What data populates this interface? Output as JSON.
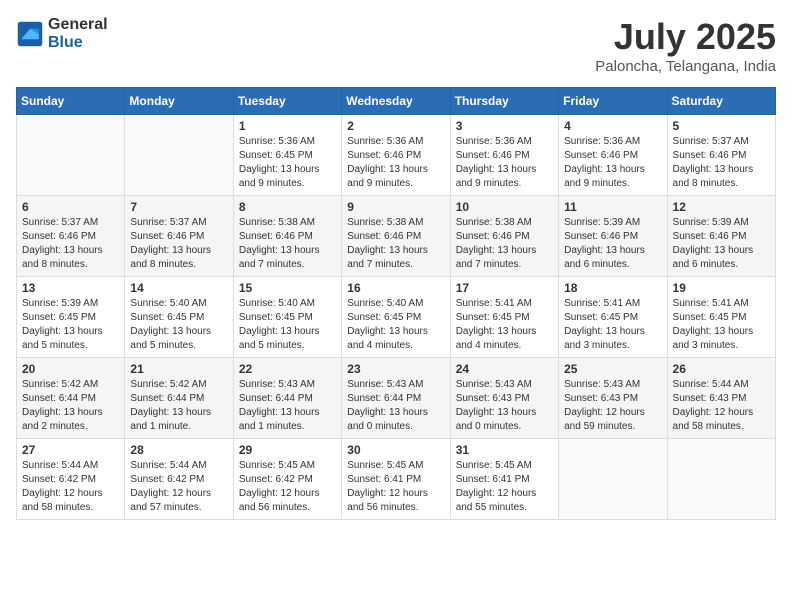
{
  "logo": {
    "general": "General",
    "blue": "Blue"
  },
  "header": {
    "month": "July 2025",
    "location": "Paloncha, Telangana, India"
  },
  "weekdays": [
    "Sunday",
    "Monday",
    "Tuesday",
    "Wednesday",
    "Thursday",
    "Friday",
    "Saturday"
  ],
  "weeks": [
    [
      {
        "day": "",
        "info": ""
      },
      {
        "day": "",
        "info": ""
      },
      {
        "day": "1",
        "info": "Sunrise: 5:36 AM\nSunset: 6:45 PM\nDaylight: 13 hours and 9 minutes."
      },
      {
        "day": "2",
        "info": "Sunrise: 5:36 AM\nSunset: 6:46 PM\nDaylight: 13 hours and 9 minutes."
      },
      {
        "day": "3",
        "info": "Sunrise: 5:36 AM\nSunset: 6:46 PM\nDaylight: 13 hours and 9 minutes."
      },
      {
        "day": "4",
        "info": "Sunrise: 5:36 AM\nSunset: 6:46 PM\nDaylight: 13 hours and 9 minutes."
      },
      {
        "day": "5",
        "info": "Sunrise: 5:37 AM\nSunset: 6:46 PM\nDaylight: 13 hours and 8 minutes."
      }
    ],
    [
      {
        "day": "6",
        "info": "Sunrise: 5:37 AM\nSunset: 6:46 PM\nDaylight: 13 hours and 8 minutes."
      },
      {
        "day": "7",
        "info": "Sunrise: 5:37 AM\nSunset: 6:46 PM\nDaylight: 13 hours and 8 minutes."
      },
      {
        "day": "8",
        "info": "Sunrise: 5:38 AM\nSunset: 6:46 PM\nDaylight: 13 hours and 7 minutes."
      },
      {
        "day": "9",
        "info": "Sunrise: 5:38 AM\nSunset: 6:46 PM\nDaylight: 13 hours and 7 minutes."
      },
      {
        "day": "10",
        "info": "Sunrise: 5:38 AM\nSunset: 6:46 PM\nDaylight: 13 hours and 7 minutes."
      },
      {
        "day": "11",
        "info": "Sunrise: 5:39 AM\nSunset: 6:46 PM\nDaylight: 13 hours and 6 minutes."
      },
      {
        "day": "12",
        "info": "Sunrise: 5:39 AM\nSunset: 6:46 PM\nDaylight: 13 hours and 6 minutes."
      }
    ],
    [
      {
        "day": "13",
        "info": "Sunrise: 5:39 AM\nSunset: 6:45 PM\nDaylight: 13 hours and 5 minutes."
      },
      {
        "day": "14",
        "info": "Sunrise: 5:40 AM\nSunset: 6:45 PM\nDaylight: 13 hours and 5 minutes."
      },
      {
        "day": "15",
        "info": "Sunrise: 5:40 AM\nSunset: 6:45 PM\nDaylight: 13 hours and 5 minutes."
      },
      {
        "day": "16",
        "info": "Sunrise: 5:40 AM\nSunset: 6:45 PM\nDaylight: 13 hours and 4 minutes."
      },
      {
        "day": "17",
        "info": "Sunrise: 5:41 AM\nSunset: 6:45 PM\nDaylight: 13 hours and 4 minutes."
      },
      {
        "day": "18",
        "info": "Sunrise: 5:41 AM\nSunset: 6:45 PM\nDaylight: 13 hours and 3 minutes."
      },
      {
        "day": "19",
        "info": "Sunrise: 5:41 AM\nSunset: 6:45 PM\nDaylight: 13 hours and 3 minutes."
      }
    ],
    [
      {
        "day": "20",
        "info": "Sunrise: 5:42 AM\nSunset: 6:44 PM\nDaylight: 13 hours and 2 minutes."
      },
      {
        "day": "21",
        "info": "Sunrise: 5:42 AM\nSunset: 6:44 PM\nDaylight: 13 hours and 1 minute."
      },
      {
        "day": "22",
        "info": "Sunrise: 5:43 AM\nSunset: 6:44 PM\nDaylight: 13 hours and 1 minutes."
      },
      {
        "day": "23",
        "info": "Sunrise: 5:43 AM\nSunset: 6:44 PM\nDaylight: 13 hours and 0 minutes."
      },
      {
        "day": "24",
        "info": "Sunrise: 5:43 AM\nSunset: 6:43 PM\nDaylight: 13 hours and 0 minutes."
      },
      {
        "day": "25",
        "info": "Sunrise: 5:43 AM\nSunset: 6:43 PM\nDaylight: 12 hours and 59 minutes."
      },
      {
        "day": "26",
        "info": "Sunrise: 5:44 AM\nSunset: 6:43 PM\nDaylight: 12 hours and 58 minutes."
      }
    ],
    [
      {
        "day": "27",
        "info": "Sunrise: 5:44 AM\nSunset: 6:42 PM\nDaylight: 12 hours and 58 minutes."
      },
      {
        "day": "28",
        "info": "Sunrise: 5:44 AM\nSunset: 6:42 PM\nDaylight: 12 hours and 57 minutes."
      },
      {
        "day": "29",
        "info": "Sunrise: 5:45 AM\nSunset: 6:42 PM\nDaylight: 12 hours and 56 minutes."
      },
      {
        "day": "30",
        "info": "Sunrise: 5:45 AM\nSunset: 6:41 PM\nDaylight: 12 hours and 56 minutes."
      },
      {
        "day": "31",
        "info": "Sunrise: 5:45 AM\nSunset: 6:41 PM\nDaylight: 12 hours and 55 minutes."
      },
      {
        "day": "",
        "info": ""
      },
      {
        "day": "",
        "info": ""
      }
    ]
  ]
}
